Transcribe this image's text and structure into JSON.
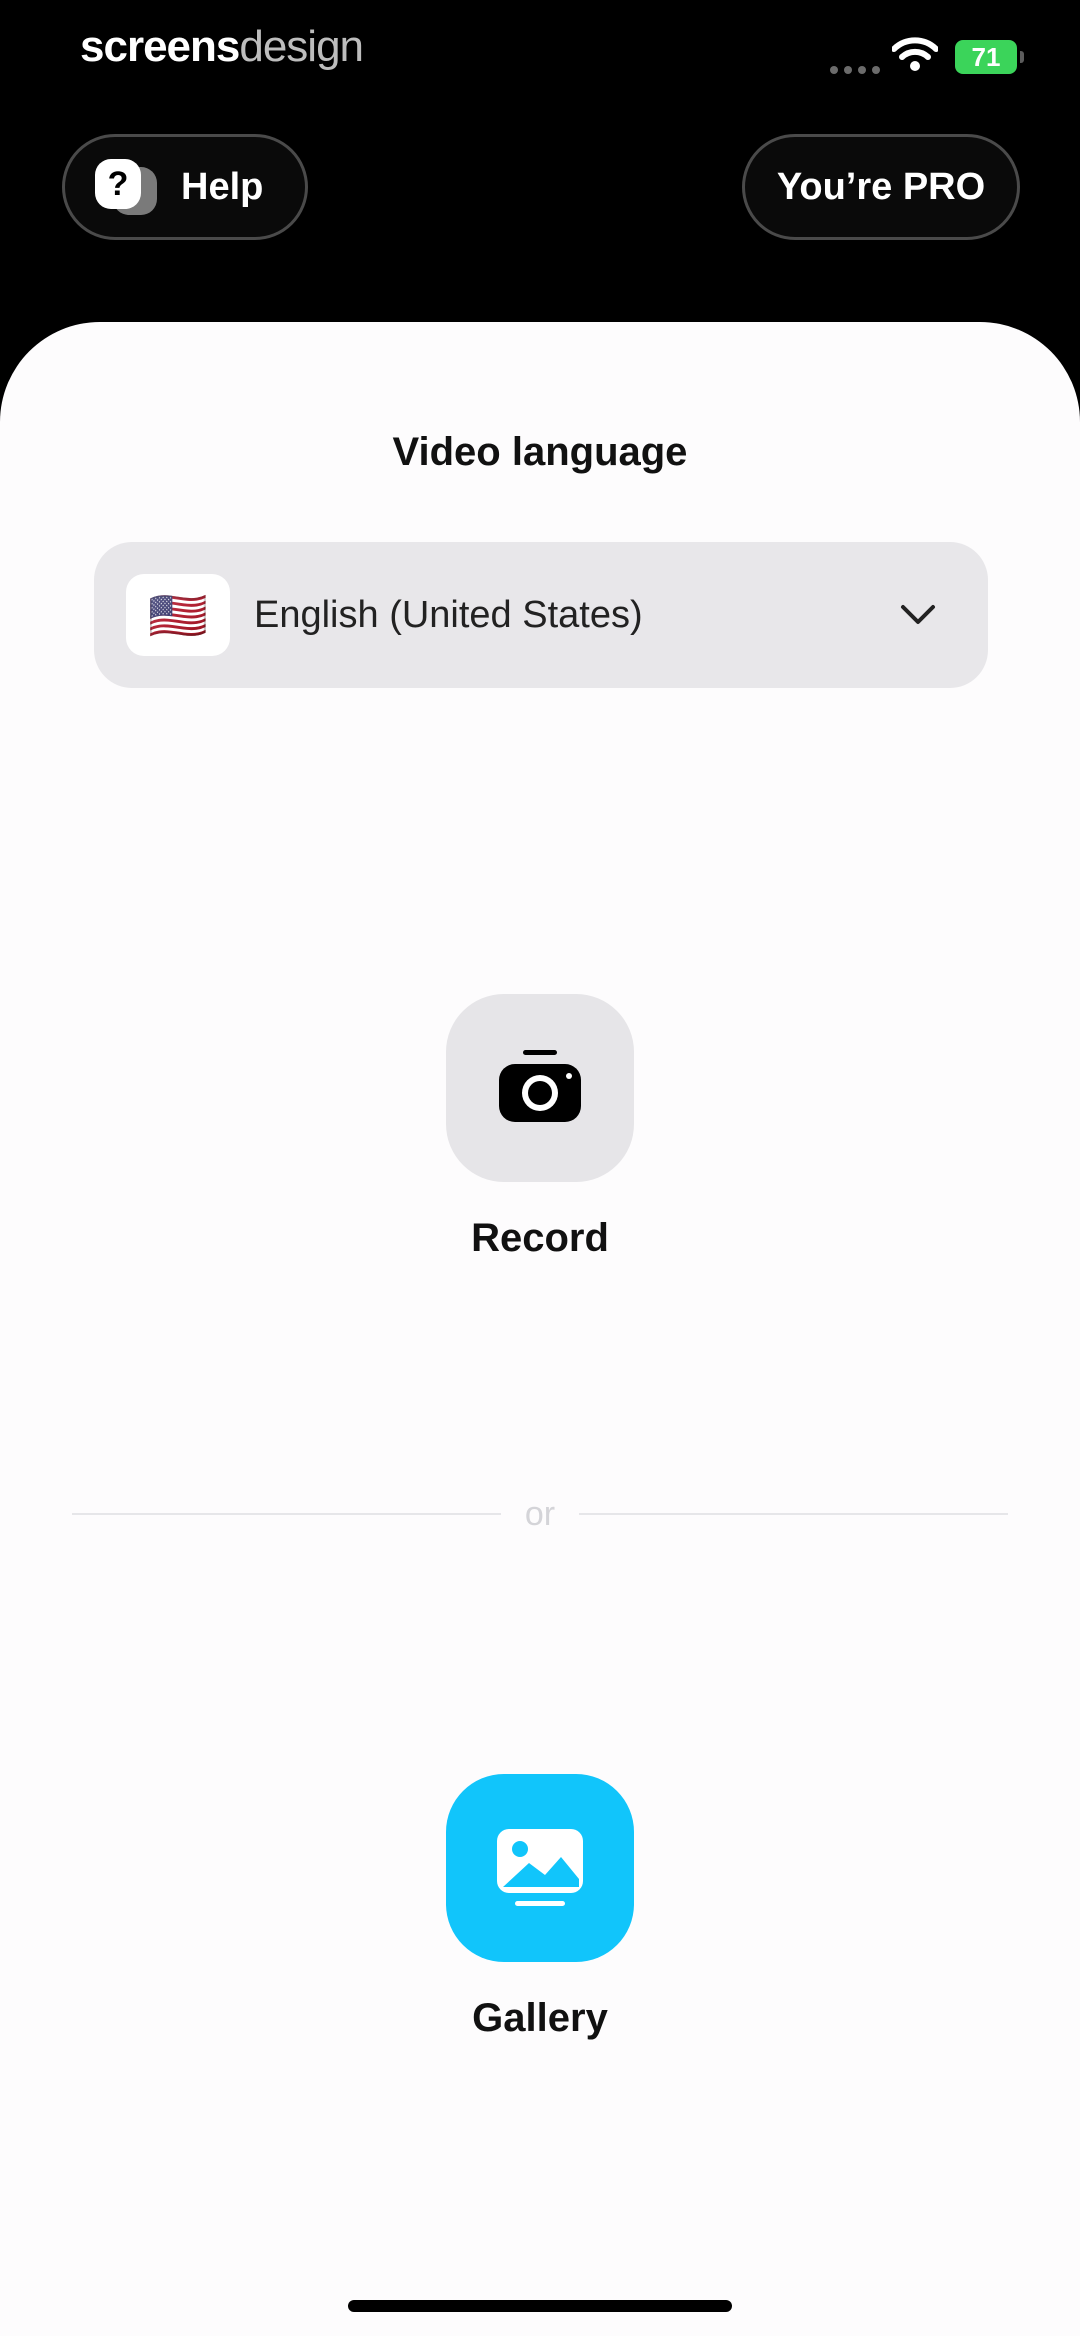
{
  "status_bar": {
    "watermark_a": "screens",
    "watermark_b": "design",
    "battery_level": "71"
  },
  "header": {
    "help_label": "Help",
    "help_icon_glyph": "?",
    "pro_label": "You’re PRO"
  },
  "language": {
    "title": "Video language",
    "flag": "🇺🇸",
    "selected": "English (United States)",
    "flag_icon": "us-flag-icon",
    "chevron_icon": "chevron-down-icon"
  },
  "actions": {
    "record_label": "Record",
    "record_icon": "camera-icon",
    "separator": "or",
    "gallery_label": "Gallery",
    "gallery_icon": "image-icon"
  },
  "colors": {
    "background_dark": "#000000",
    "sheet": "#fdfcfd",
    "select_bg": "#e8e7ea",
    "gallery_accent": "#11c5fb",
    "battery": "#3bd45a"
  }
}
